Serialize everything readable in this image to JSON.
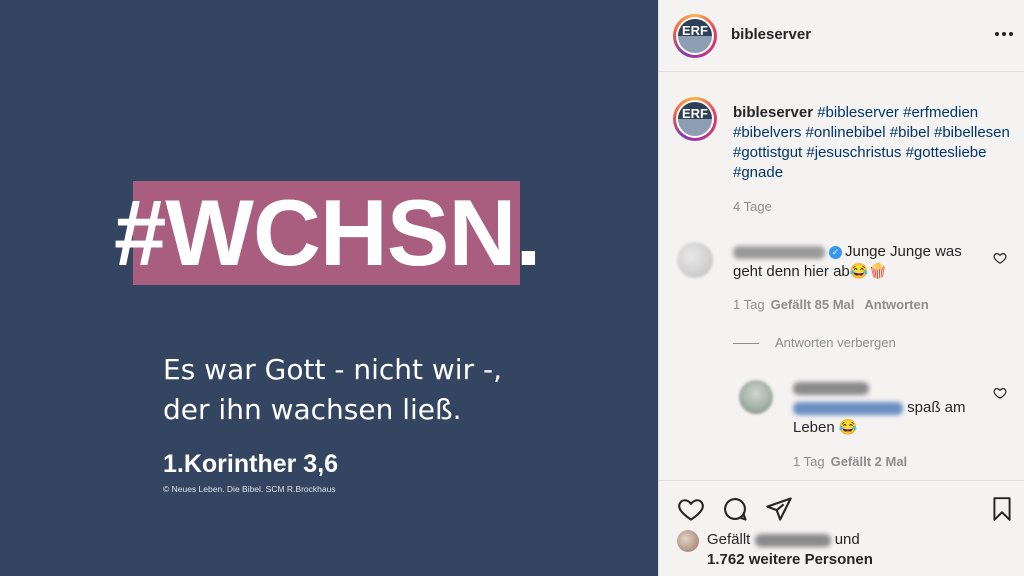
{
  "post_image": {
    "hashtag": "#WCHSN",
    "hashtag_dot": ".",
    "verse_line1": "Es war Gott - nicht wir -,",
    "verse_line2": "der ihn wachsen ließ.",
    "reference": "1.Korinther 3,6",
    "copyright": "© Neues Leben. Die Bibel. SCM R.Brockhaus",
    "colors": {
      "background": "#334560",
      "highlight": "#a95e80"
    }
  },
  "header": {
    "avatar_logo": "ERF",
    "username": "bibleserver",
    "more_icon": "more-horizontal-icon"
  },
  "caption": {
    "username": "bibleserver",
    "tags": "#bibleserver #erfmedien #bibelvers #onlinebibel #bibel #bibellesen #gottistgut #jesuschristus #gottesliebe #gnade",
    "time": "4 Tage"
  },
  "comments": [
    {
      "text": "Junge Junge was geht denn hier ab😂🍿",
      "time": "1 Tag",
      "likes": "Gefällt 85 Mal",
      "reply": "Antworten",
      "verified": true
    }
  ],
  "replies_toggle": "Antworten verbergen",
  "replies": [
    {
      "text": "spaß am Leben 😂",
      "time": "1 Tag",
      "likes": "Gefällt 2 Mal"
    }
  ],
  "actions": {
    "icons": [
      "heart-icon",
      "comment-icon",
      "share-icon",
      "bookmark-icon"
    ],
    "likes_prefix": "Gefällt",
    "likes_and": "und",
    "likes_rest": "1.762 weitere Personen"
  }
}
